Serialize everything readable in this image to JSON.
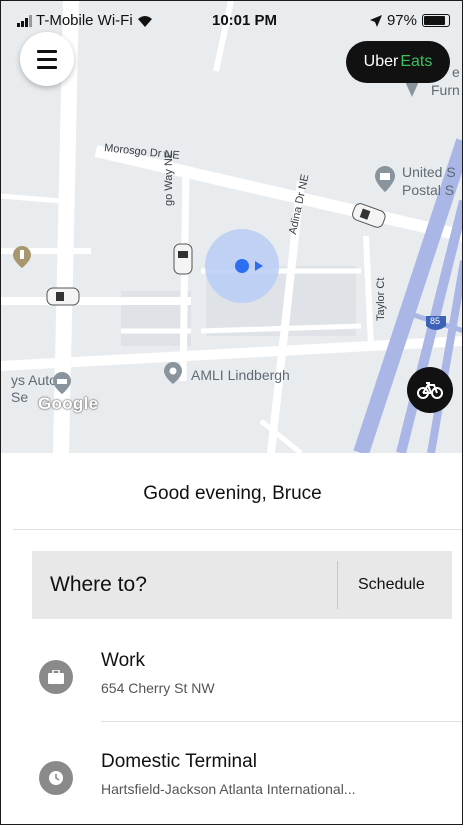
{
  "status_bar": {
    "carrier": "T-Mobile Wi-Fi",
    "time": "10:01 PM",
    "battery": "97%"
  },
  "map": {
    "roads": [
      "Morosgo Dr NE",
      "go Way NE",
      "Adina Dr NE",
      "Taylor Ct"
    ],
    "shield": "85",
    "pois": [
      {
        "name": "AMLI Lindbergh"
      },
      {
        "name": "United S\nPostal S"
      },
      {
        "name": "ys Auto\nSe"
      },
      {
        "name": "e\nFurn"
      }
    ],
    "attribution": "Google"
  },
  "uber_eats": {
    "uber": "Uber",
    "eats": "Eats",
    "accent": "#3fc060"
  },
  "panel": {
    "greeting": "Good evening, Bruce",
    "search_label": "Where to?",
    "schedule_label": "Schedule",
    "places": [
      {
        "title": "Work",
        "subtitle": "654 Cherry St NW",
        "icon": "briefcase-icon"
      },
      {
        "title": "Domestic Terminal",
        "subtitle": "Hartsfield-Jackson Atlanta International...",
        "icon": "clock-icon"
      }
    ]
  },
  "colors": {
    "map_bg": "#e9ecef",
    "location": "#2d6ff0",
    "search_bg": "#e8e8e8"
  }
}
